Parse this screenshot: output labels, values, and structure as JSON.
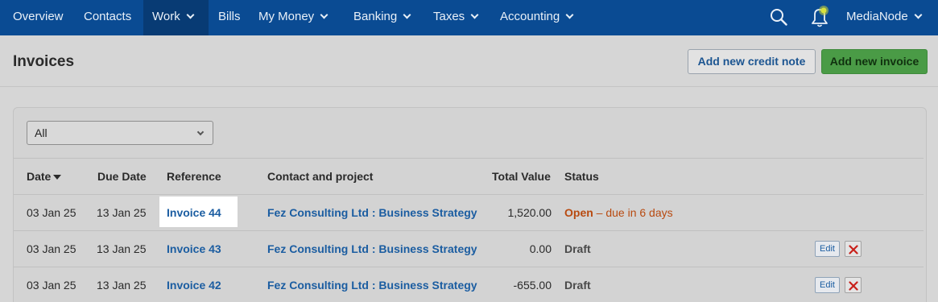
{
  "nav": {
    "items": [
      {
        "label": "Overview"
      },
      {
        "label": "Contacts"
      },
      {
        "label": "Work"
      },
      {
        "label": "Bills"
      },
      {
        "label": "My Money"
      },
      {
        "label": "Banking"
      },
      {
        "label": "Taxes"
      },
      {
        "label": "Accounting"
      }
    ],
    "account": "MediaNode",
    "active": "Work"
  },
  "page": {
    "title": "Invoices",
    "btn_credit": "Add new credit note",
    "btn_invoice": "Add new invoice"
  },
  "filter": {
    "selected": "All"
  },
  "table": {
    "headers": {
      "date": "Date",
      "due": "Due Date",
      "ref": "Reference",
      "contact": "Contact and project",
      "total": "Total Value",
      "status": "Status"
    },
    "rows": [
      {
        "date": "03 Jan 25",
        "due": "13 Jan 25",
        "ref": "Invoice 44",
        "contact": "Fez Consulting Ltd : Business Strategy",
        "total": "1,520.00",
        "status": "Open",
        "status_detail": " – due in 6 days"
      },
      {
        "date": "03 Jan 25",
        "due": "13 Jan 25",
        "ref": "Invoice 43",
        "contact": "Fez Consulting Ltd : Business Strategy",
        "total": "0.00",
        "status": "Draft",
        "edit": "Edit"
      },
      {
        "date": "03 Jan 25",
        "due": "13 Jan 25",
        "ref": "Invoice 42",
        "contact": "Fez Consulting Ltd : Business Strategy",
        "total": "-655.00",
        "status": "Draft",
        "edit": "Edit"
      }
    ]
  },
  "colors": {
    "nav_bg": "#0a4b93",
    "link": "#1b5da1",
    "open_status": "#b84a10",
    "primary_button": "#4a9b46"
  },
  "icons": [
    "chevron-down-icon",
    "search-icon",
    "bell-icon",
    "sort-desc-icon",
    "delete-icon"
  ]
}
